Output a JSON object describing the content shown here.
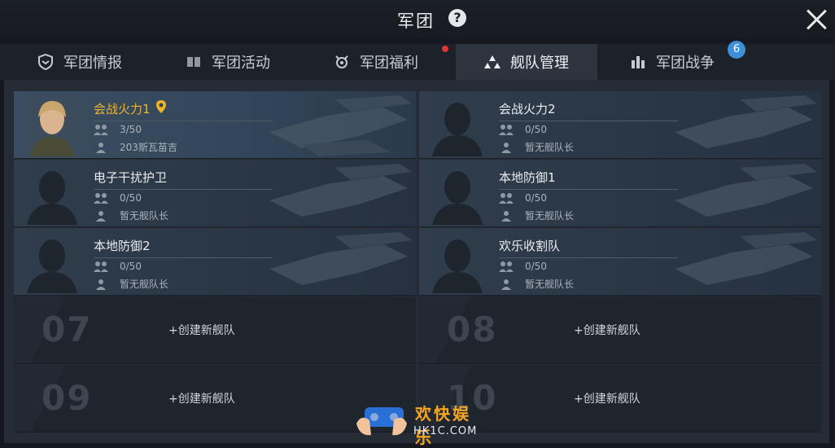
{
  "header": {
    "title": "军团",
    "help_label": "?"
  },
  "tabs": [
    {
      "label": "军团情报",
      "icon": "shield-icon"
    },
    {
      "label": "军团活动",
      "icon": "book-icon"
    },
    {
      "label": "军团福利",
      "icon": "gift-icon"
    },
    {
      "label": "舰队管理",
      "icon": "fleet-icon",
      "active": true
    },
    {
      "label": "军团战争",
      "icon": "war-icon",
      "badge": "6"
    }
  ],
  "fleets": [
    {
      "name": "会战火力1",
      "members": "3/50",
      "captain": "203斯瓦苗吉",
      "highlight": true
    },
    {
      "name": "会战火力2",
      "members": "0/50",
      "captain": "暂无舰队长"
    },
    {
      "name": "电子干扰护卫",
      "members": "0/50",
      "captain": "暂无舰队长"
    },
    {
      "name": "本地防御1",
      "members": "0/50",
      "captain": "暂无舰队长"
    },
    {
      "name": "本地防御2",
      "members": "0/50",
      "captain": "暂无舰队长"
    },
    {
      "name": "欢乐收割队",
      "members": "0/50",
      "captain": "暂无舰队长"
    }
  ],
  "slots": [
    {
      "num": "07",
      "label": "+创建新舰队"
    },
    {
      "num": "08",
      "label": "+创建新舰队"
    },
    {
      "num": "09",
      "label": "+创建新舰队"
    },
    {
      "num": "10",
      "label": "+创建新舰队"
    }
  ],
  "watermark": {
    "text": "欢快娱乐",
    "url": "HK1C.COM"
  },
  "colors": {
    "accent_gold": "#f0b429",
    "badge_blue": "#3c8fd8",
    "red_dot": "#e0333a"
  }
}
